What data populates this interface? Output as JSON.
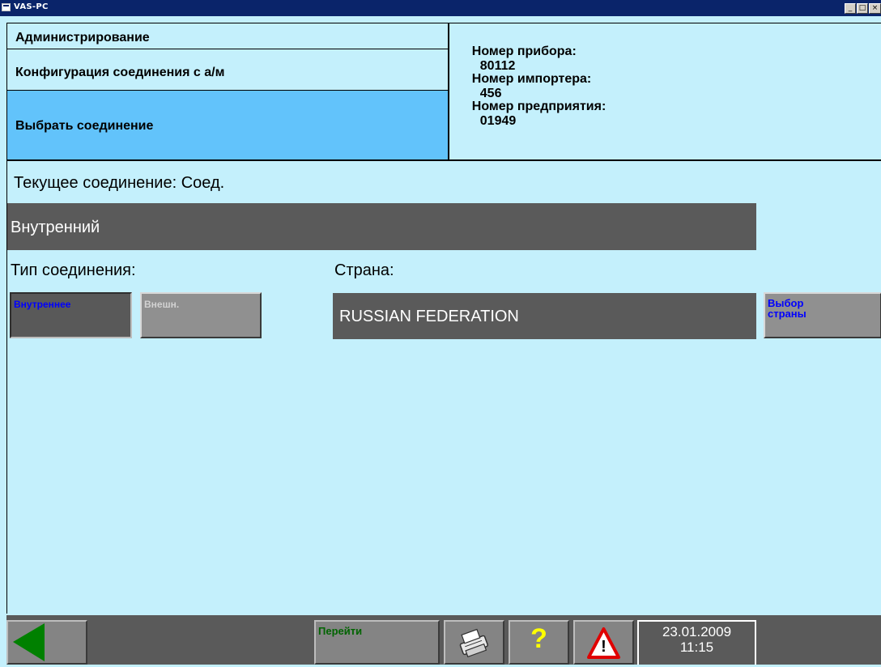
{
  "window": {
    "title": "VAS-PC",
    "min_label": "_",
    "max_label": "□",
    "close_label": "×"
  },
  "header": {
    "menu": [
      {
        "label": "Администрирование"
      },
      {
        "label": "Конфигурация соединения с а/м"
      },
      {
        "label": "Выбрать соединение",
        "active": true
      }
    ],
    "info": [
      {
        "label": "Номер прибора:",
        "value": "80112"
      },
      {
        "label": "Номер импортера:",
        "value": "456"
      },
      {
        "label": "Номер предприятия:",
        "value": "01949"
      }
    ]
  },
  "main": {
    "current_connection_label": "Текущее соединение: Соед.",
    "current_connection_value": "Внутренний",
    "connection_type_label": "Тип соединения:",
    "country_label": "Страна:",
    "country_value": "RUSSIAN FEDERATION",
    "internal_button": "Внутреннее",
    "external_button": "Внешн.",
    "select_country_button_line1": "Выбор",
    "select_country_button_line2": "страны"
  },
  "bottom": {
    "go_button": "Перейти",
    "help_glyph": "?",
    "warning_glyph": "!",
    "date": "23.01.2009",
    "time": "11:15"
  },
  "colors": {
    "background": "#c4f0fc",
    "active_menu": "#62c3fb",
    "dark_bar": "#5a5a5a",
    "button_blue_text": "#0000ff",
    "go_text": "#006400",
    "back_arrow": "#008000"
  }
}
